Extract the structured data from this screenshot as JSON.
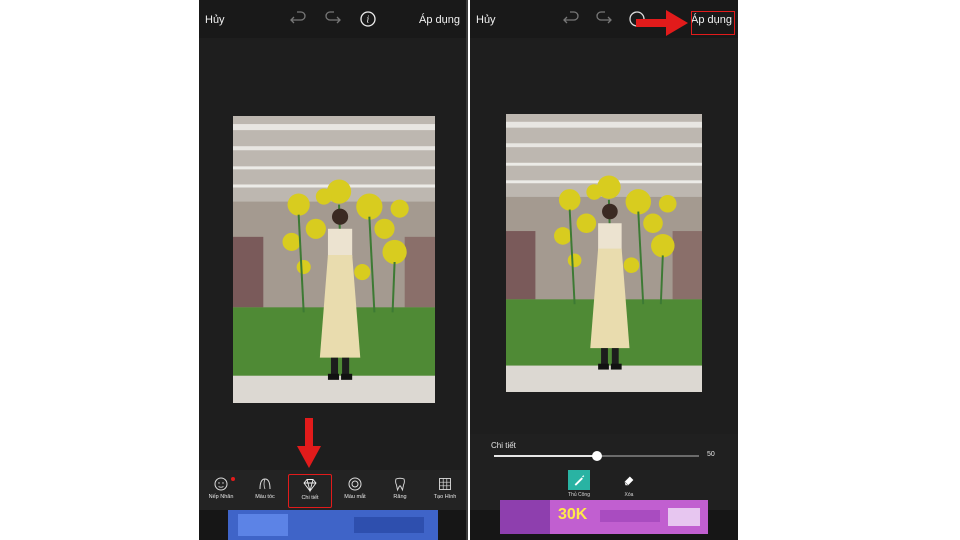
{
  "left_panel": {
    "topbar": {
      "cancel_label": "Hủy",
      "apply_label": "Áp dụng"
    },
    "tools": [
      {
        "label": "Nếp Nhăn"
      },
      {
        "label": "Màu tóc"
      },
      {
        "label": "Chi tiết"
      },
      {
        "label": "Màu mắt"
      },
      {
        "label": "Răng"
      },
      {
        "label": "Tạo Hình"
      }
    ],
    "active_tool": "Chi tiết"
  },
  "right_panel": {
    "topbar": {
      "cancel_label": "Hủy",
      "apply_label": "Áp dụng"
    },
    "detail": {
      "label": "Chi tiết",
      "value": "50",
      "slider_fraction": 0.5
    },
    "modes": [
      {
        "label": "Thủ Công"
      },
      {
        "label": "Xóa"
      }
    ],
    "ad_text": "30K"
  },
  "colors": {
    "app_bg": "#161616",
    "accent": "#29b3a3",
    "annotation": "#e21b1b"
  }
}
